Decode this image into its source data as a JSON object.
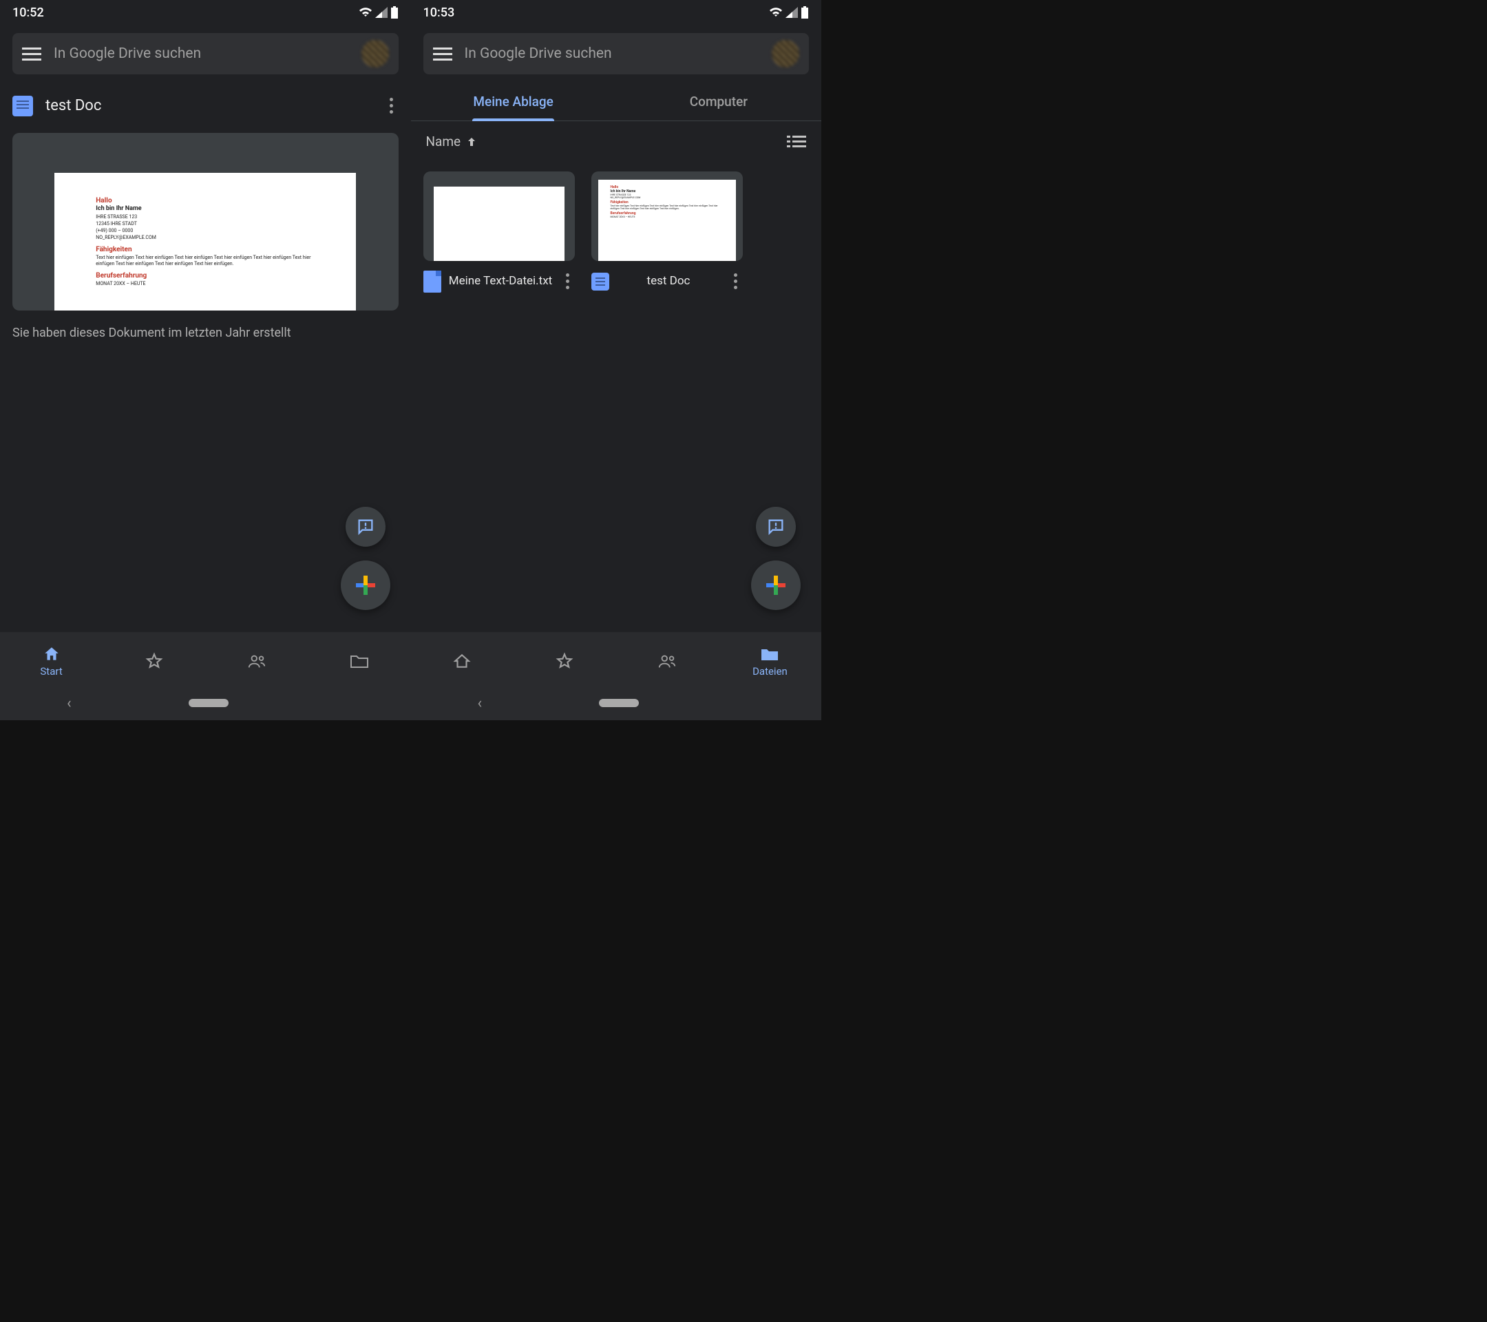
{
  "left": {
    "status_time": "10:52",
    "search_placeholder": "In Google Drive suchen",
    "doc_title": "test Doc",
    "preview": {
      "greeting": "Hallo",
      "name_line": "Ich bin Ihr Name",
      "address1": "IHRE STRASSE 123",
      "address2": "12345 IHRE STADT",
      "phone": "(+49) 000 – 0000",
      "email": "NO_REPLY@EXAMPLE.COM",
      "skills_heading": "Fähigkeiten",
      "skills_body": "Text hier einfügen Text hier einfügen Text hier einfügen Text hier einfügen Text hier einfügen Text hier einfügen Text hier einfügen Text hier einfügen Text hier einfügen.",
      "exp_heading": "Berufserfahrung",
      "exp_date": "MONAT 20XX – HEUTE"
    },
    "caption": "Sie haben dieses Dokument im letzten Jahr erstellt",
    "nav": {
      "start": "Start"
    }
  },
  "right": {
    "status_time": "10:53",
    "search_placeholder": "In Google Drive suchen",
    "tabs": {
      "drive": "Meine Ablage",
      "computer": "Computer"
    },
    "sort_label": "Name",
    "files": [
      {
        "name": "Meine Text-Datei.txt"
      },
      {
        "name": "test Doc"
      }
    ],
    "nav": {
      "files": "Dateien"
    }
  }
}
